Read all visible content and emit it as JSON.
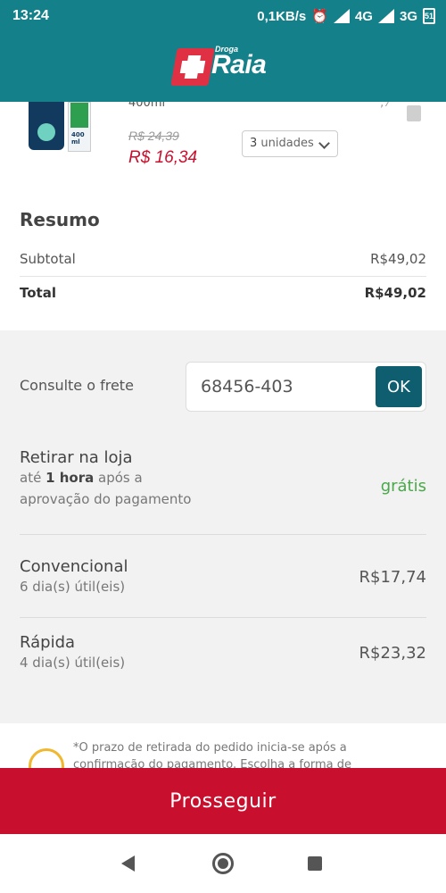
{
  "status_bar": {
    "time": "13:24",
    "speed": "0,1KB/s",
    "network1": "4G",
    "network2": "3G",
    "battery": "51"
  },
  "header": {
    "brand_small": "Droga",
    "brand_big": "Raia"
  },
  "product": {
    "name_partial": "400ml",
    "volume_label": "400 ml",
    "price_old": "R$ 24,39",
    "price_new": "R$ 16,34",
    "quantity_number": "3",
    "quantity_unit": "unidades"
  },
  "summary": {
    "title": "Resumo",
    "subtotal_label": "Subtotal",
    "subtotal_value": "R$49,02",
    "total_label": "Total",
    "total_value": "R$49,02"
  },
  "shipping": {
    "consult_label": "Consulte o frete",
    "cep_value": "68456-403",
    "ok_label": "OK",
    "options": [
      {
        "title": "Retirar na loja",
        "sub_prefix": "até ",
        "sub_bold": "1 hora",
        "sub_suffix": " após a",
        "sub_line2": "aprovação do pagamento",
        "price": "grátis"
      },
      {
        "title": "Convencional",
        "sub": "6 dia(s) útil(eis)",
        "price": "R$17,74"
      },
      {
        "title": "Rápida",
        "sub": "4 dia(s) útil(eis)",
        "price": "R$23,32"
      }
    ],
    "note": "*O prazo de retirada do pedido inicia-se após a confirmação do pagamento. Escolha a forma de"
  },
  "footer": {
    "proceed_label": "Prosseguir"
  },
  "colors": {
    "header_teal": "#14808a",
    "accent_red": "#c8102e",
    "ok_teal": "#0e5e6f",
    "free_green": "#4aa84a"
  }
}
